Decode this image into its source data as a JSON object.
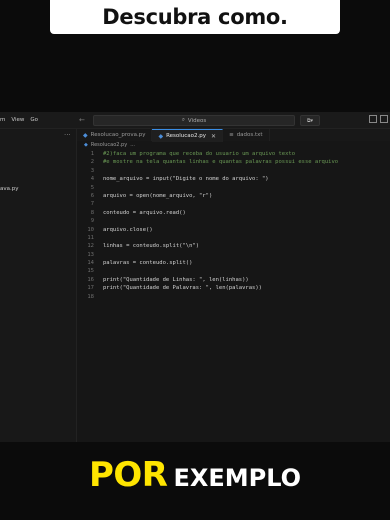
{
  "banner": {
    "text": "Descubra como."
  },
  "titlebar": {
    "menu": [
      "m",
      "View",
      "Go"
    ],
    "search_text": "Videos",
    "nav_back": "←",
    "nav_forward": "→"
  },
  "sidebar": {
    "more": "···",
    "file_fragment": "ava.py"
  },
  "tabs": [
    {
      "label": "Resolucao_prova.py",
      "icon": "python-file-icon",
      "active": false
    },
    {
      "label": "Resolucao2.py",
      "icon": "python-file-icon",
      "active": true
    },
    {
      "label": "dados.txt",
      "icon": "text-file-icon",
      "active": false
    }
  ],
  "breadcrumb": {
    "file": "Resolucao2.py",
    "rest": "..."
  },
  "code": [
    {
      "n": "1",
      "text": "#2)faca um programa que receba do usuario um arquivo texto",
      "kind": "comment"
    },
    {
      "n": "2",
      "text": "#e mostre na tela quantas linhas e quantas palavras possui esse arquivo",
      "kind": "comment"
    },
    {
      "n": "3",
      "text": "",
      "kind": "plain"
    },
    {
      "n": "4",
      "text": "nome_arquivo = input(\"Digite o nome do arquivo: \")",
      "kind": "plain"
    },
    {
      "n": "5",
      "text": "",
      "kind": "plain"
    },
    {
      "n": "6",
      "text": "arquivo = open(nome_arquivo, \"r\")",
      "kind": "plain"
    },
    {
      "n": "7",
      "text": "",
      "kind": "plain"
    },
    {
      "n": "8",
      "text": "conteudo = arquivo.read()",
      "kind": "plain"
    },
    {
      "n": "9",
      "text": "",
      "kind": "plain"
    },
    {
      "n": "10",
      "text": "arquivo.close()",
      "kind": "plain"
    },
    {
      "n": "11",
      "text": "",
      "kind": "plain"
    },
    {
      "n": "12",
      "text": "linhas = conteudo.split(\"\\n\")",
      "kind": "plain"
    },
    {
      "n": "13",
      "text": "",
      "kind": "plain"
    },
    {
      "n": "14",
      "text": "palavras = conteudo.split()",
      "kind": "plain"
    },
    {
      "n": "15",
      "text": "",
      "kind": "plain"
    },
    {
      "n": "16",
      "text": "print(\"Quantidade de Linhas: \", len(linhas))",
      "kind": "plain"
    },
    {
      "n": "17",
      "text": "print(\"Quantidade de Palavras: \", len(palavras))",
      "kind": "plain"
    },
    {
      "n": "18",
      "text": "",
      "kind": "plain"
    }
  ],
  "caption": {
    "highlight": "POR",
    "rest": "EXEMPLO"
  },
  "colors": {
    "highlight": "#ffe500",
    "tab_accent": "#3a8ee6",
    "comment": "#6a9955"
  }
}
